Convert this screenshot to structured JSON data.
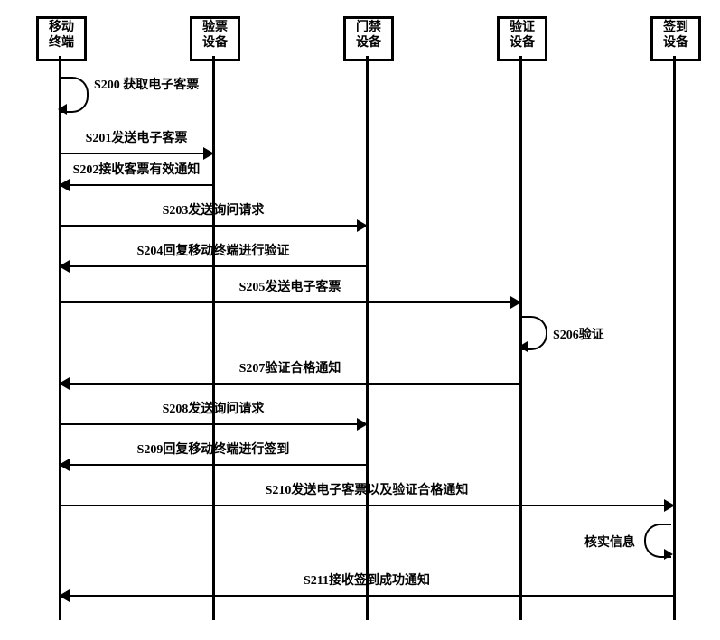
{
  "participants": {
    "p1": {
      "line1": "移动",
      "line2": "终端"
    },
    "p2": {
      "line1": "验票",
      "line2": "设备"
    },
    "p3": {
      "line1": "门禁",
      "line2": "设备"
    },
    "p4": {
      "line1": "验证",
      "line2": "设备"
    },
    "p5": {
      "line1": "签到",
      "line2": "设备"
    }
  },
  "loops": {
    "s200": "S200 获取电子客票",
    "s206": "S206验证",
    "verify_info": "核实信息"
  },
  "messages": {
    "s201": "S201发送电子客票",
    "s202": "S202接收客票有效通知",
    "s203": "S203发送询问请求",
    "s204": "S204回复移动终端进行验证",
    "s205": "S205发送电子客票",
    "s207": "S207验证合格通知",
    "s208": "S208发送询问请求",
    "s209": "S209回复移动终端进行签到",
    "s210": "S210发送电子客票以及验证合格通知",
    "s211": "S211接收签到成功通知"
  }
}
